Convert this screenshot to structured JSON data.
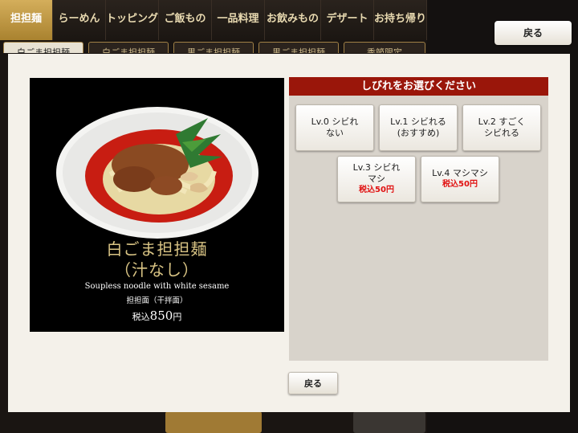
{
  "nav": {
    "tabs": [
      "担担麺",
      "らーめん",
      "トッピング",
      "ご飯もの",
      "一品料理",
      "お飲みもの",
      "デザート",
      "お持ち帰り"
    ],
    "active_index": 0,
    "subtabs": [
      "白ごま担担麺",
      "白ごま担担麺",
      "黒ごま担担麺",
      "黒ごま担担麺",
      "季節限定"
    ]
  },
  "header": {
    "back_label": "戻る"
  },
  "product": {
    "name_ja_line1": "白ごま担担麺",
    "name_ja_line2": "（汁なし）",
    "name_en": "Soupless noodle with white sesame",
    "name_cn": "担担面（干拌面）",
    "price_tax_label": "税込",
    "price_value": "850",
    "price_unit": "円"
  },
  "spice_panel": {
    "title": "しびれをお選びください",
    "options": [
      {
        "line1": "Lv.0 シビれ",
        "line2": "ない",
        "surcharge": ""
      },
      {
        "line1": "Lv.1 シビれる",
        "line2": "(おすすめ)",
        "surcharge": ""
      },
      {
        "line1": "Lv.2 すごく",
        "line2": "シビれる",
        "surcharge": ""
      },
      {
        "line1": "Lv.3 シビれ",
        "line2": "マシ",
        "surcharge": "税込50円"
      },
      {
        "line1": "Lv.4 マシマシ",
        "line2": "",
        "surcharge": "税込50円"
      }
    ]
  },
  "modal": {
    "back_label": "戻る"
  }
}
